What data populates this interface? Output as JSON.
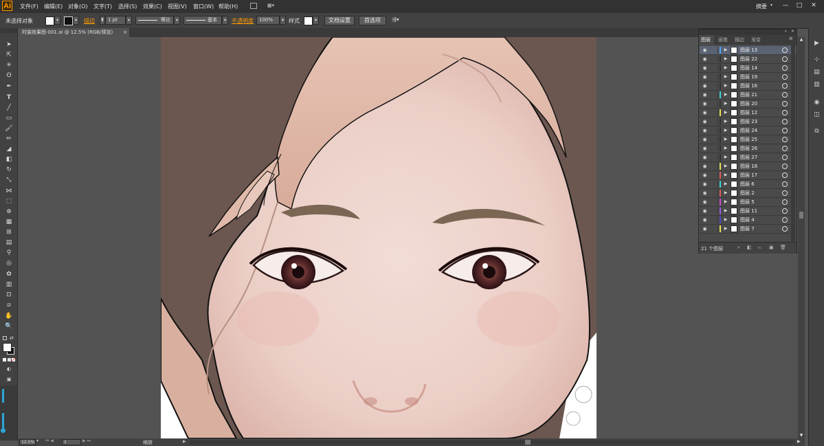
{
  "menubar": {
    "logo": "Ai",
    "items": [
      "文件(F)",
      "编辑(E)",
      "对象(O)",
      "文字(T)",
      "选择(S)",
      "效果(C)",
      "视图(V)",
      "窗口(W)",
      "帮助(H)"
    ],
    "workspace": "摘要",
    "window_controls": [
      "—",
      "□",
      "✕"
    ]
  },
  "controlbar": {
    "selection_label": "未选择对象",
    "stroke_label": "描边",
    "stroke_value": "1 pt",
    "profile_label": "等比",
    "brush_label": "基本",
    "opacity_label": "不透明度",
    "opacity_value": "100%",
    "style_label": "样式",
    "doc_setup_button": "文档设置",
    "prefs_button": "首选项"
  },
  "document_tab": {
    "title": "时装效果图-001.ai @ 12.5% (RGB/预览)",
    "close": "×"
  },
  "statusbar": {
    "zoom": "12.5%",
    "artboard": "1",
    "status_text": "缩放"
  },
  "layers_panel": {
    "tabs": [
      "图层",
      "画笔",
      "描边",
      "渐变"
    ],
    "active_tab": "图层",
    "count_text": "21 个图层",
    "layers": [
      {
        "name": "图层 13",
        "color": "#4aa3ff",
        "selected": true
      },
      {
        "name": "图层 22",
        "color": "#333333",
        "selected": false
      },
      {
        "name": "图层 14",
        "color": "#333333",
        "selected": false
      },
      {
        "name": "图层 19",
        "color": "#333333",
        "selected": false
      },
      {
        "name": "图层 16",
        "color": "#333333",
        "selected": false
      },
      {
        "name": "图层 21",
        "color": "#3fd3d3",
        "selected": false
      },
      {
        "name": "图层 20",
        "color": "#333333",
        "selected": false
      },
      {
        "name": "图层 12",
        "color": "#e8e04a",
        "selected": false
      },
      {
        "name": "图层 23",
        "color": "#333333",
        "selected": false
      },
      {
        "name": "图层 24",
        "color": "#333333",
        "selected": false
      },
      {
        "name": "图层 25",
        "color": "#333333",
        "selected": false
      },
      {
        "name": "图层 26",
        "color": "#333333",
        "selected": false
      },
      {
        "name": "图层 27",
        "color": "#333333",
        "selected": false
      },
      {
        "name": "图层 18",
        "color": "#e8e04a",
        "selected": false
      },
      {
        "name": "图层 17",
        "color": "#e05a5a",
        "selected": false
      },
      {
        "name": "图层 6",
        "color": "#3fd3d3",
        "selected": false
      },
      {
        "name": "图层 2",
        "color": "#e05a5a",
        "selected": false
      },
      {
        "name": "图层 5",
        "color": "#d04ad0",
        "selected": false
      },
      {
        "name": "图层 11",
        "color": "#9a5ae0",
        "selected": false
      },
      {
        "name": "图层 4",
        "color": "#4a4ad0",
        "selected": false
      },
      {
        "name": "图层 7",
        "color": "#e8e04a",
        "selected": false
      }
    ]
  }
}
